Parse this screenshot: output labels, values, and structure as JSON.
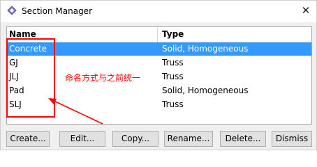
{
  "window": {
    "title": "Section Manager",
    "icon": "section-manager-icon",
    "close_label": "✕"
  },
  "list": {
    "headers": {
      "name": "Name",
      "type": "Type"
    },
    "rows": [
      {
        "name": "Concrete",
        "type": "Solid, Homogeneous",
        "selected": true
      },
      {
        "name": "GJ",
        "type": "Truss"
      },
      {
        "name": "JLJ",
        "type": "Truss"
      },
      {
        "name": "Pad",
        "type": "Solid, Homogeneous"
      },
      {
        "name": "SLJ",
        "type": "Truss"
      }
    ]
  },
  "annotation": {
    "text": "命名方式与之前统一",
    "color": "#ff0000"
  },
  "buttons": {
    "create": "Create...",
    "edit": "Edit...",
    "copy": "Copy...",
    "rename": "Rename...",
    "delete": "Delete...",
    "dismiss": "Dismiss"
  },
  "colors": {
    "selection": "#3399ff",
    "background": "#f0f0f0"
  }
}
